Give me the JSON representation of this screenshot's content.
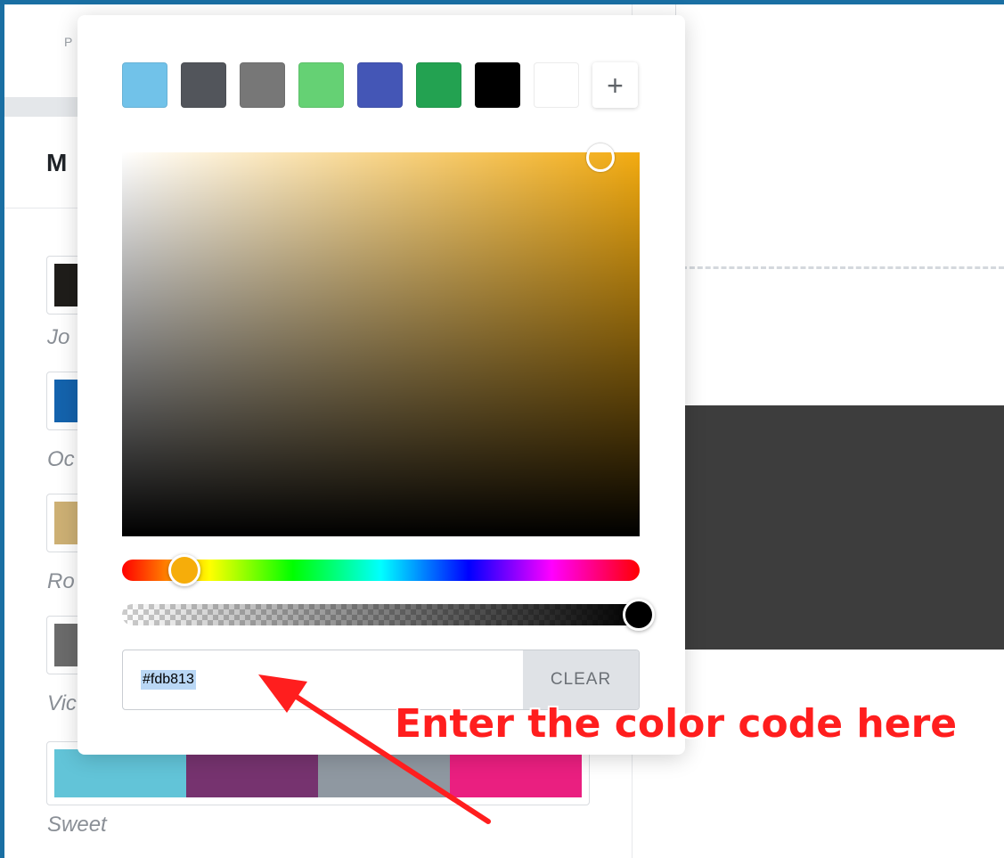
{
  "left_panel": {
    "top_label": "P",
    "section_title": "M",
    "presets": [
      {
        "name": "Jo",
        "color": "#1f1d1a"
      },
      {
        "name": "Oc",
        "color": "#1463ad"
      },
      {
        "name": "Ro",
        "color": "#cdb074"
      },
      {
        "name": "Vic",
        "color": "#6b6b6b"
      }
    ],
    "palette": {
      "name": "Sweet",
      "colors": [
        "#62c4d8",
        "#76336f",
        "#8f98a1",
        "#ea1f80"
      ]
    }
  },
  "picker": {
    "swatches": [
      {
        "name": "light-blue",
        "color": "#71c2e9"
      },
      {
        "name": "dark-gray",
        "color": "#52555b"
      },
      {
        "name": "gray",
        "color": "#777777"
      },
      {
        "name": "light-green",
        "color": "#65d174"
      },
      {
        "name": "blue",
        "color": "#4456b6"
      },
      {
        "name": "green",
        "color": "#23a251"
      },
      {
        "name": "black",
        "color": "#000000"
      },
      {
        "name": "white",
        "color": "#ffffff"
      }
    ],
    "add_label": "+",
    "hue_color": "#f3ab10",
    "hue_handle_color": "#f6ad0a",
    "alpha_level": 1.0,
    "hex_value": "#fdb813",
    "clear_label": "CLEAR"
  },
  "annotation": {
    "text": "Enter the color code here",
    "color": "#ff1e1e"
  },
  "canvas": {
    "block_color": "#3d3d3d"
  }
}
